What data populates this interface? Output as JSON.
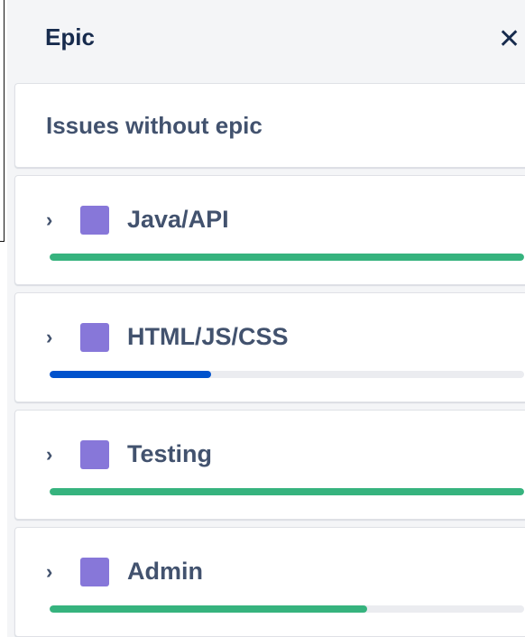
{
  "panel": {
    "title": "Epic",
    "close_icon": "close-icon",
    "issues_without_epic": "Issues without epic"
  },
  "epics": [
    {
      "name": "Java/API",
      "color": "#8777d9",
      "progress": 1.0,
      "progress_color": "#36b37e"
    },
    {
      "name": "HTML/JS/CSS",
      "color": "#8777d9",
      "progress": 0.34,
      "progress_color": "#0052cc"
    },
    {
      "name": "Testing",
      "color": "#8777d9",
      "progress": 1.0,
      "progress_color": "#36b37e"
    },
    {
      "name": "Admin",
      "color": "#8777d9",
      "progress": 0.67,
      "progress_color": "#36b37e"
    }
  ]
}
